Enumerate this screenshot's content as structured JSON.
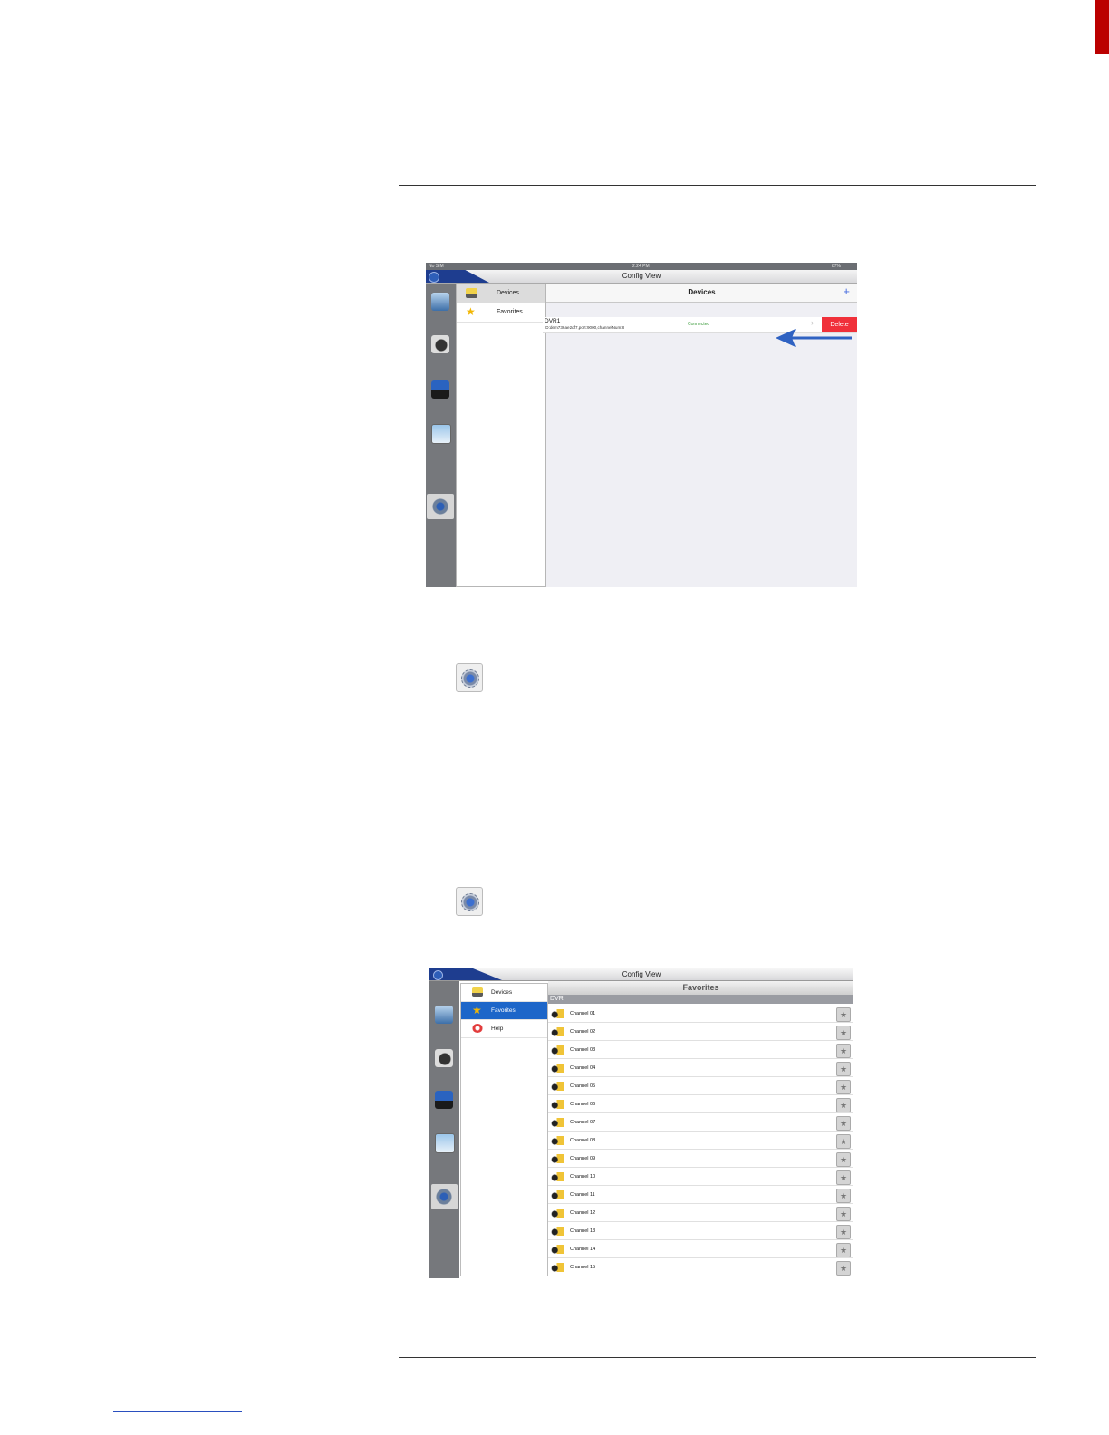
{
  "shot1": {
    "status": {
      "carrier": "No SIM",
      "time": "2:24 PM",
      "battery": "87%"
    },
    "window_title": "Config View",
    "menu": [
      {
        "label": "Devices"
      },
      {
        "label": "Favorites"
      }
    ],
    "nav_title": "Devices",
    "add_symbol": "+",
    "device": {
      "name": "DVR1",
      "detail": "ID:dem736ae2df7,port:9000,channelNum:8",
      "status": "Connected",
      "chevron": "›"
    },
    "delete_label": "Delete"
  },
  "shot2": {
    "window_title": "Config View",
    "menu": [
      {
        "label": "Devices"
      },
      {
        "label": "Favorites"
      },
      {
        "label": "Help"
      }
    ],
    "header": "Favorites",
    "section": "DVR",
    "channels": [
      "Channel 01",
      "Channel 02",
      "Channel 03",
      "Channel 04",
      "Channel 05",
      "Channel 06",
      "Channel 07",
      "Channel 08",
      "Channel 09",
      "Channel 10",
      "Channel 11",
      "Channel 12",
      "Channel 13",
      "Channel 14",
      "Channel 15"
    ]
  },
  "colors": {
    "accent": "#1d66c9",
    "delete": "#f0303a",
    "arrow": "#2f62c2",
    "connected": "#3a9a3a"
  }
}
